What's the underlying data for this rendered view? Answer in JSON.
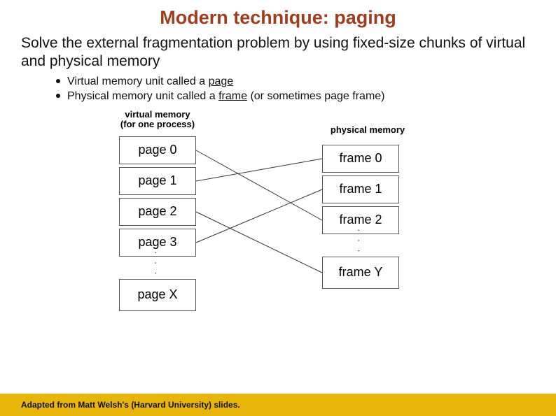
{
  "title": "Modern technique: paging",
  "subtitle": "Solve the external fragmentation problem by using fixed-size chunks of virtual and physical memory",
  "bullets": [
    {
      "prefix": "Virtual memory unit called a ",
      "underlined": "page",
      "suffix": ""
    },
    {
      "prefix": "Physical memory unit called a ",
      "underlined": "frame",
      "suffix": " (or sometimes page frame)"
    }
  ],
  "diagram": {
    "vm_label_line1": "virtual memory",
    "vm_label_line2": "(for one process)",
    "pm_label": "physical memory",
    "vm_cells": [
      "page 0",
      "page 1",
      "page 2",
      "page 3"
    ],
    "vm_last": "page X",
    "pm_cells": [
      "frame 0",
      "frame 1",
      "frame 2"
    ],
    "pm_last": "frame Y",
    "ellipsis": ". . ."
  },
  "footer": "Adapted from Matt Welsh's (Harvard University) slides."
}
